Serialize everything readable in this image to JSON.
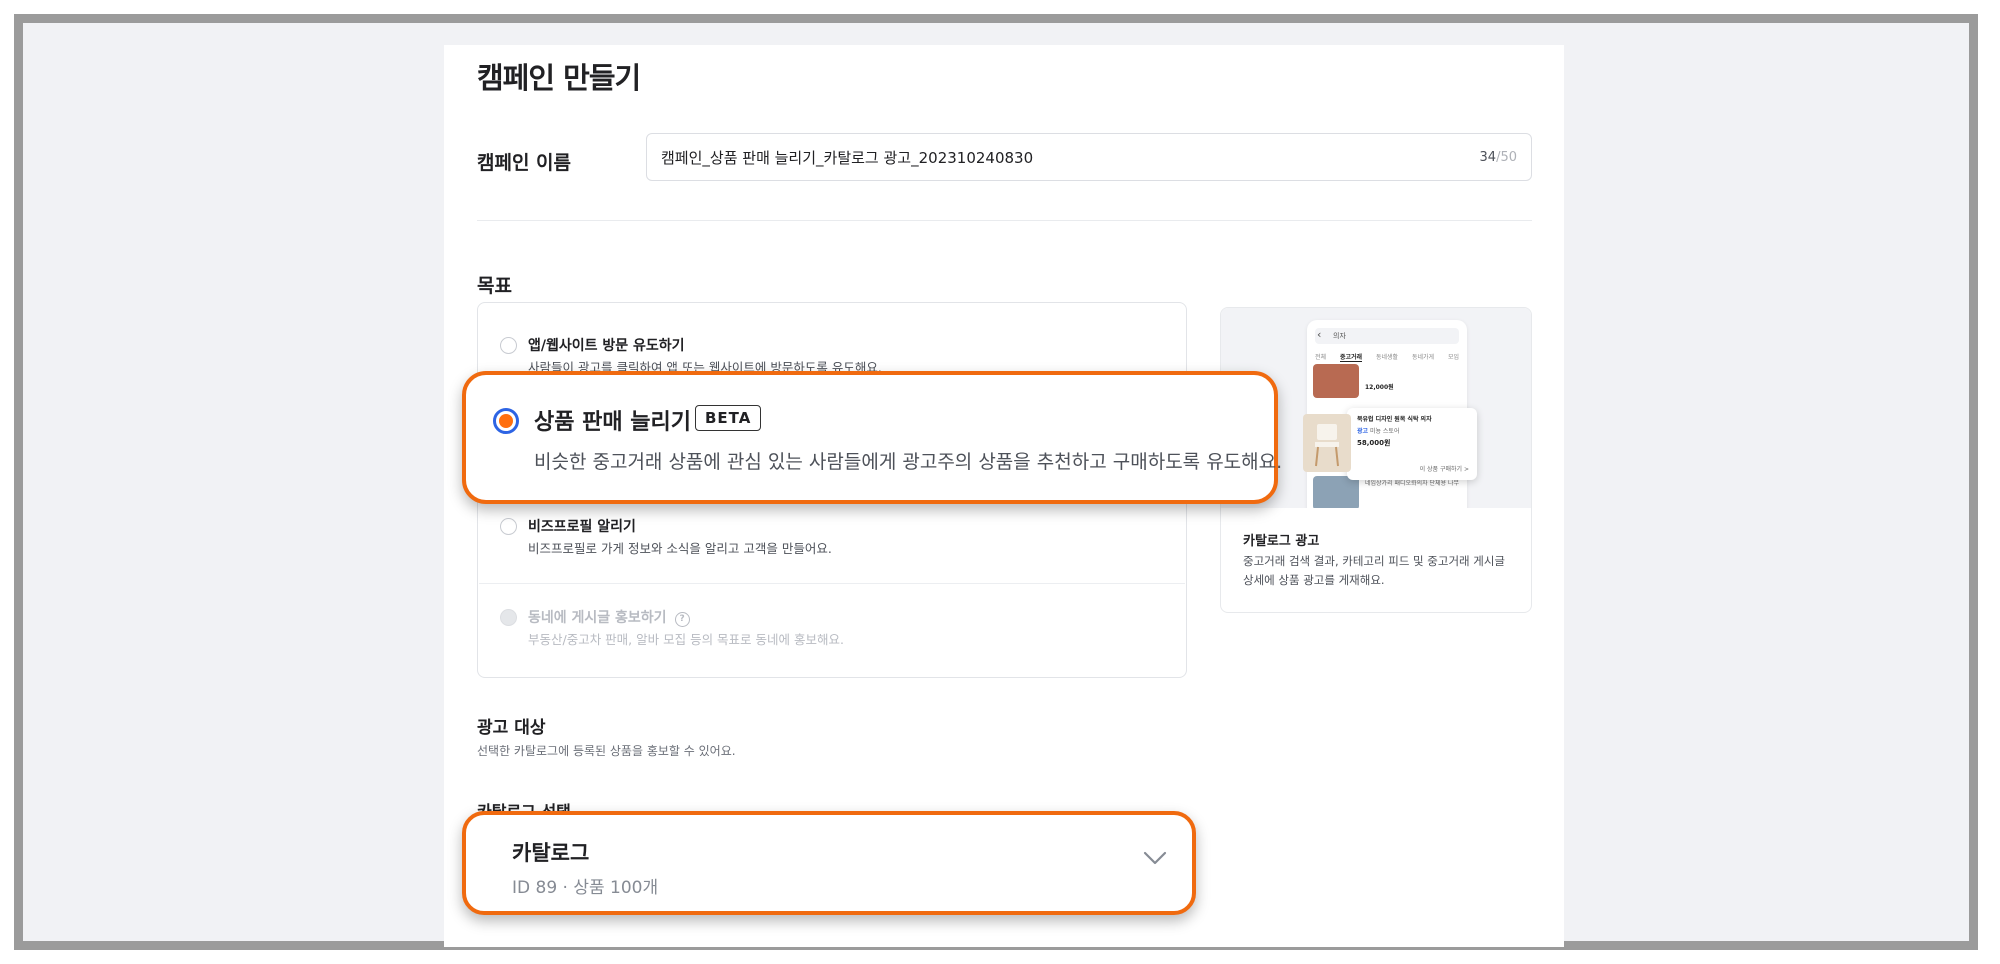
{
  "page": {
    "title": "캠페인 만들기"
  },
  "campaign_name": {
    "label": "캠페인 이름",
    "value": "캠페인_상품 판매 늘리기_카탈로그 광고_202310240830",
    "count": "34",
    "max": "/50"
  },
  "goal": {
    "label": "목표",
    "options": [
      {
        "title": "앱/웹사이트 방문 유도하기",
        "desc": "사람들이 광고를 클릭하여 앱 또는 웹사이트에 방문하도록 유도해요.",
        "state": "unselected"
      },
      {
        "title": "상품 판매 늘리기",
        "badge": "BETA",
        "desc": "비슷한 중고거래 상품에 관심 있는 사람들에게 광고주의 상품을 추천하고 구매하도록 유도해요.",
        "state": "selected"
      },
      {
        "title": "비즈프로필 알리기",
        "desc": "비즈프로필로 가게 정보와 소식을 알리고 고객을 만들어요.",
        "state": "unselected"
      },
      {
        "title": "동네에 게시글 홍보하기",
        "desc": "부동산/중고차 판매, 알바 모집 등의 목표로 동네에 홍보해요.",
        "state": "disabled",
        "help_icon": "question-circle-icon"
      }
    ]
  },
  "preview": {
    "search_text": "의자",
    "tabs": [
      "전체",
      "중고거래",
      "동네생활",
      "동네가게",
      "모임"
    ],
    "price_1": "12,000원",
    "item_title": "북유럽 디자인 원목 식탁 의자",
    "item_tag": "광고",
    "item_shop": "미뇽 스토어",
    "item_price": "58,000원",
    "item_link": "이 상품 구매하기 >",
    "item_bottom": "네임상가리 패디오롸의자 단체용 나무",
    "title": "카탈로그 광고",
    "desc": "중고거래 검색 결과, 카테고리 피드 및 중고거래 게시글 상세에 상품 광고를 게재해요."
  },
  "target": {
    "label": "광고 대상",
    "desc": "선택한 카탈로그에 등록된 상품을 홍보할 수 있어요."
  },
  "catalog": {
    "label": "카탈로그 선택",
    "name": "카탈로그",
    "meta": "ID 89 · 상품 100개"
  },
  "colors": {
    "accent_orange": "#f06a0f",
    "radio_blue": "#2d64e4",
    "radio_fill": "#ff6f0f"
  }
}
